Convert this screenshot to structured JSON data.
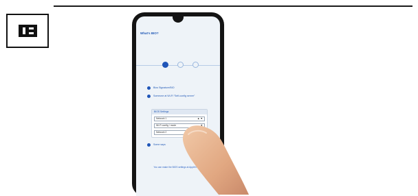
{
  "page": {
    "step_icon": "step-marker-icon",
    "colors": {
      "accent": "#1f55b8",
      "screen_bg": "#eef3f8",
      "phone_body": "#141414",
      "rule": "#1a1a1a"
    }
  },
  "phone_screen": {
    "title": "What's BIO?",
    "steps": {
      "total": 3,
      "active_index": 0
    },
    "options": [
      {
        "label": "Bios Signature/BIO"
      },
      {
        "label": "Someone at Wi-Fi \"Self-config server\""
      }
    ],
    "settings_panel": {
      "heading": "BIOS Settings",
      "fields": [
        {
          "label": "Network 1",
          "control": "▲ ▼"
        },
        {
          "label": "Wi-Fi config / mode",
          "control": "▼"
        },
        {
          "label": "Network 2",
          "control": ""
        }
      ]
    },
    "extra_option": {
      "label": "Some says"
    },
    "footer_link": "You can make the BIOS settings at Apple's BIOS"
  }
}
